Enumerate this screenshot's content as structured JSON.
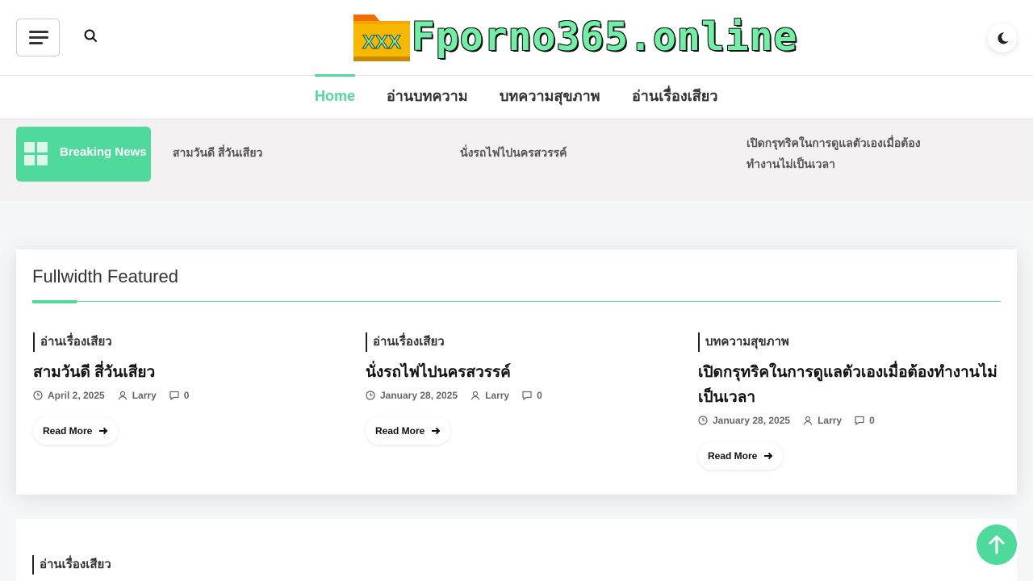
{
  "header": {
    "menu_icon": "hamburger-menu-icon",
    "search_icon": "search-icon",
    "logo_text": "Fporno365.online",
    "logo_badge": "XXX",
    "dark_mode_icon": "moon-icon"
  },
  "nav": {
    "items": [
      {
        "label": "Home"
      },
      {
        "label": "อ่านบทความ"
      },
      {
        "label": "บทความสุขภาพ"
      },
      {
        "label": "อ่านเรื่องเสียว"
      }
    ]
  },
  "breaking": {
    "label": "Breaking News",
    "items": [
      "สามวันดี สี่วันเสียว",
      "นั่งรถไฟไปนครสวรรค์",
      "เปิดกรุทริคในการดูแลตัวเองเมื่อต้องทำงานไม่เป็นเวลา"
    ]
  },
  "featured": {
    "title": "Fullwidth Featured",
    "posts": [
      {
        "category": "อ่านเรื่องเสียว",
        "title": "สามวันดี สี่วันเสียว",
        "date": "April 2, 2025",
        "author": "Larry",
        "comments": "0",
        "read_more": "Read More"
      },
      {
        "category": "อ่านเรื่องเสียว",
        "title": "นั่งรถไฟไปนครสวรรค์",
        "date": "January 28, 2025",
        "author": "Larry",
        "comments": "0",
        "read_more": "Read More"
      },
      {
        "category": "บทความสุขภาพ",
        "title": "เปิดกรุทริคในการดูแลตัวเองเมื่อต้องทำงานไม่เป็นเวลา",
        "date": "January 28, 2025",
        "author": "Larry",
        "comments": "0",
        "read_more": "Read More"
      }
    ]
  },
  "next_section": {
    "category": "อ่านเรื่องเสียว"
  },
  "colors": {
    "accent": "#4fd99a",
    "logo_text": "#6ff0a6",
    "ticker_bg": "#f3f1f2"
  },
  "scroll_top_icon": "arrow-up-icon"
}
